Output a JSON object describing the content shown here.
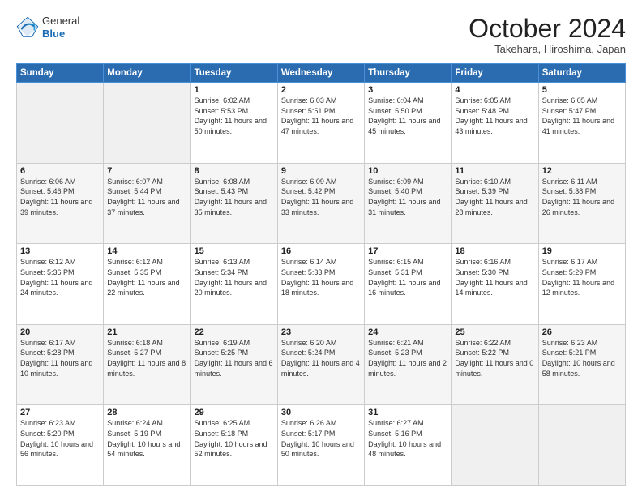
{
  "logo": {
    "general": "General",
    "blue": "Blue"
  },
  "header": {
    "month": "October 2024",
    "location": "Takehara, Hiroshima, Japan"
  },
  "days_of_week": [
    "Sunday",
    "Monday",
    "Tuesday",
    "Wednesday",
    "Thursday",
    "Friday",
    "Saturday"
  ],
  "weeks": [
    [
      {
        "day": "",
        "info": ""
      },
      {
        "day": "",
        "info": ""
      },
      {
        "day": "1",
        "info": "Sunrise: 6:02 AM\nSunset: 5:53 PM\nDaylight: 11 hours and 50 minutes."
      },
      {
        "day": "2",
        "info": "Sunrise: 6:03 AM\nSunset: 5:51 PM\nDaylight: 11 hours and 47 minutes."
      },
      {
        "day": "3",
        "info": "Sunrise: 6:04 AM\nSunset: 5:50 PM\nDaylight: 11 hours and 45 minutes."
      },
      {
        "day": "4",
        "info": "Sunrise: 6:05 AM\nSunset: 5:48 PM\nDaylight: 11 hours and 43 minutes."
      },
      {
        "day": "5",
        "info": "Sunrise: 6:05 AM\nSunset: 5:47 PM\nDaylight: 11 hours and 41 minutes."
      }
    ],
    [
      {
        "day": "6",
        "info": "Sunrise: 6:06 AM\nSunset: 5:46 PM\nDaylight: 11 hours and 39 minutes."
      },
      {
        "day": "7",
        "info": "Sunrise: 6:07 AM\nSunset: 5:44 PM\nDaylight: 11 hours and 37 minutes."
      },
      {
        "day": "8",
        "info": "Sunrise: 6:08 AM\nSunset: 5:43 PM\nDaylight: 11 hours and 35 minutes."
      },
      {
        "day": "9",
        "info": "Sunrise: 6:09 AM\nSunset: 5:42 PM\nDaylight: 11 hours and 33 minutes."
      },
      {
        "day": "10",
        "info": "Sunrise: 6:09 AM\nSunset: 5:40 PM\nDaylight: 11 hours and 31 minutes."
      },
      {
        "day": "11",
        "info": "Sunrise: 6:10 AM\nSunset: 5:39 PM\nDaylight: 11 hours and 28 minutes."
      },
      {
        "day": "12",
        "info": "Sunrise: 6:11 AM\nSunset: 5:38 PM\nDaylight: 11 hours and 26 minutes."
      }
    ],
    [
      {
        "day": "13",
        "info": "Sunrise: 6:12 AM\nSunset: 5:36 PM\nDaylight: 11 hours and 24 minutes."
      },
      {
        "day": "14",
        "info": "Sunrise: 6:12 AM\nSunset: 5:35 PM\nDaylight: 11 hours and 22 minutes."
      },
      {
        "day": "15",
        "info": "Sunrise: 6:13 AM\nSunset: 5:34 PM\nDaylight: 11 hours and 20 minutes."
      },
      {
        "day": "16",
        "info": "Sunrise: 6:14 AM\nSunset: 5:33 PM\nDaylight: 11 hours and 18 minutes."
      },
      {
        "day": "17",
        "info": "Sunrise: 6:15 AM\nSunset: 5:31 PM\nDaylight: 11 hours and 16 minutes."
      },
      {
        "day": "18",
        "info": "Sunrise: 6:16 AM\nSunset: 5:30 PM\nDaylight: 11 hours and 14 minutes."
      },
      {
        "day": "19",
        "info": "Sunrise: 6:17 AM\nSunset: 5:29 PM\nDaylight: 11 hours and 12 minutes."
      }
    ],
    [
      {
        "day": "20",
        "info": "Sunrise: 6:17 AM\nSunset: 5:28 PM\nDaylight: 11 hours and 10 minutes."
      },
      {
        "day": "21",
        "info": "Sunrise: 6:18 AM\nSunset: 5:27 PM\nDaylight: 11 hours and 8 minutes."
      },
      {
        "day": "22",
        "info": "Sunrise: 6:19 AM\nSunset: 5:25 PM\nDaylight: 11 hours and 6 minutes."
      },
      {
        "day": "23",
        "info": "Sunrise: 6:20 AM\nSunset: 5:24 PM\nDaylight: 11 hours and 4 minutes."
      },
      {
        "day": "24",
        "info": "Sunrise: 6:21 AM\nSunset: 5:23 PM\nDaylight: 11 hours and 2 minutes."
      },
      {
        "day": "25",
        "info": "Sunrise: 6:22 AM\nSunset: 5:22 PM\nDaylight: 11 hours and 0 minutes."
      },
      {
        "day": "26",
        "info": "Sunrise: 6:23 AM\nSunset: 5:21 PM\nDaylight: 10 hours and 58 minutes."
      }
    ],
    [
      {
        "day": "27",
        "info": "Sunrise: 6:23 AM\nSunset: 5:20 PM\nDaylight: 10 hours and 56 minutes."
      },
      {
        "day": "28",
        "info": "Sunrise: 6:24 AM\nSunset: 5:19 PM\nDaylight: 10 hours and 54 minutes."
      },
      {
        "day": "29",
        "info": "Sunrise: 6:25 AM\nSunset: 5:18 PM\nDaylight: 10 hours and 52 minutes."
      },
      {
        "day": "30",
        "info": "Sunrise: 6:26 AM\nSunset: 5:17 PM\nDaylight: 10 hours and 50 minutes."
      },
      {
        "day": "31",
        "info": "Sunrise: 6:27 AM\nSunset: 5:16 PM\nDaylight: 10 hours and 48 minutes."
      },
      {
        "day": "",
        "info": ""
      },
      {
        "day": "",
        "info": ""
      }
    ]
  ]
}
